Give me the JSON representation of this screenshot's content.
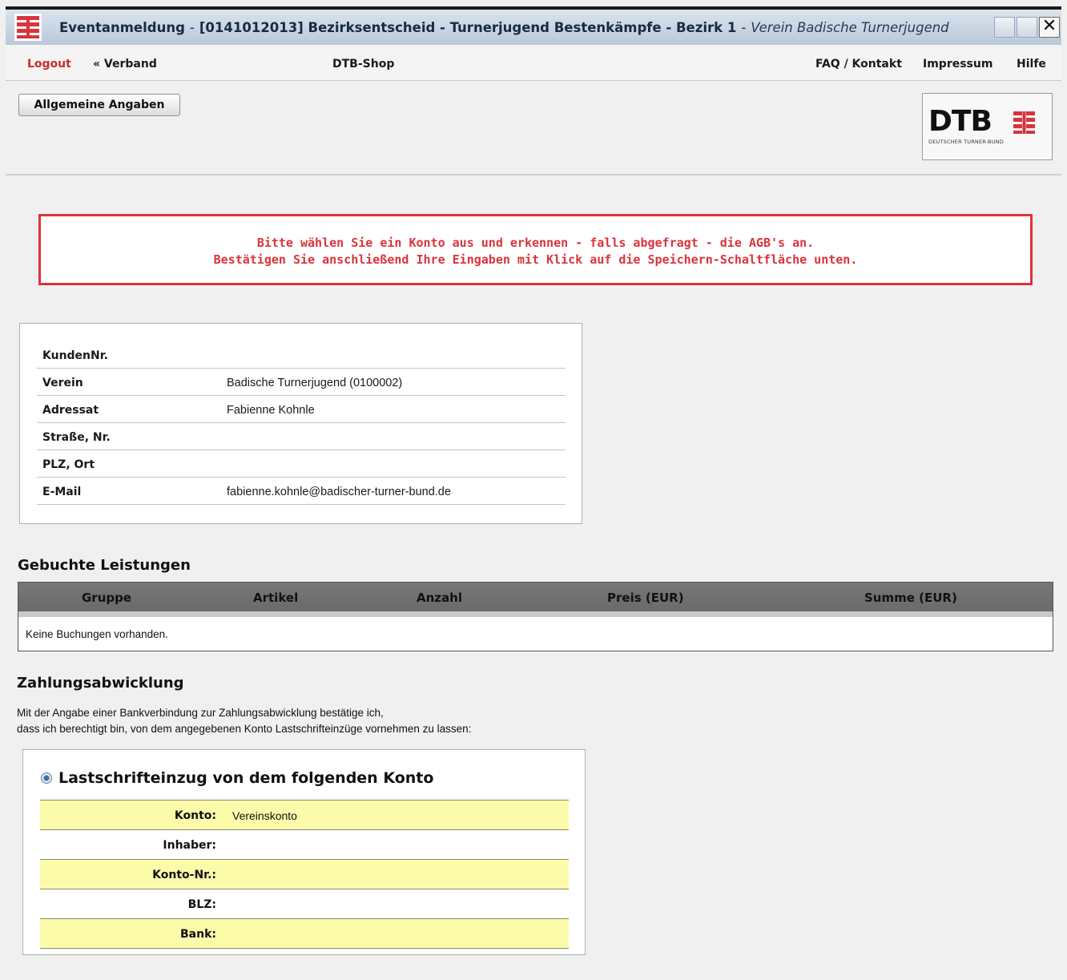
{
  "window": {
    "title_prefix": "Eventanmeldung",
    "event_title": "[0141012013] Bezirksentscheid - Turnerjugend Bestenkämpfe - Bezirk 1",
    "verein_label": "Verein Badische Turnerjugend",
    "separator": "-",
    "close_glyph": "✕"
  },
  "nav": {
    "logout": "Logout",
    "verband": "« Verband",
    "shop": "DTB-Shop",
    "faq": "FAQ / Kontakt",
    "impressum": "Impressum",
    "hilfe": "Hilfe"
  },
  "tabs": {
    "allgemeine": "Allgemeine Angaben"
  },
  "logo": {
    "word": "DTB",
    "subtitle": "DEUTSCHER TURNER-BUND",
    "color": "#d9343a"
  },
  "alert": {
    "line1": "Bitte wählen Sie ein Konto aus und erkennen - falls abgefragt - die AGB's an.",
    "line2": "Bestätigen Sie anschließend Ihre Eingaben mit Klick auf die Speichern-Schaltfläche unten."
  },
  "customer": [
    {
      "label": "KundenNr.",
      "value": ""
    },
    {
      "label": "Verein",
      "value": "Badische Turnerjugend (0100002)"
    },
    {
      "label": "Adressat",
      "value": "Fabienne Kohnle"
    },
    {
      "label": "Straße, Nr.",
      "value": ""
    },
    {
      "label": "PLZ, Ort",
      "value": ""
    },
    {
      "label": "E-Mail",
      "value": "fabienne.kohnle@badischer-turner-bund.de"
    }
  ],
  "bookings": {
    "heading": "Gebuchte Leistungen",
    "columns": [
      "Gruppe",
      "Artikel",
      "Anzahl",
      "Preis (EUR)",
      "Summe (EUR)"
    ],
    "empty_message": "Keine Buchungen vorhanden."
  },
  "payment": {
    "heading": "Zahlungsabwicklung",
    "desc_line1": "Mit der Angabe einer Bankverbindung zur Zahlungsabwicklung bestätige ich,",
    "desc_line2": "dass ich berechtigt bin, von dem angegebenen Konto Lastschrifteinzüge vornehmen zu lassen:",
    "option_label": "Lastschrifteinzug von dem folgenden Konto",
    "option_selected": true,
    "fields": [
      {
        "label": "Konto:",
        "value": "Vereinskonto"
      },
      {
        "label": "Inhaber:",
        "value": ""
      },
      {
        "label": "Konto-Nr.:",
        "value": ""
      },
      {
        "label": "BLZ:",
        "value": ""
      },
      {
        "label": "Bank:",
        "value": ""
      }
    ]
  }
}
